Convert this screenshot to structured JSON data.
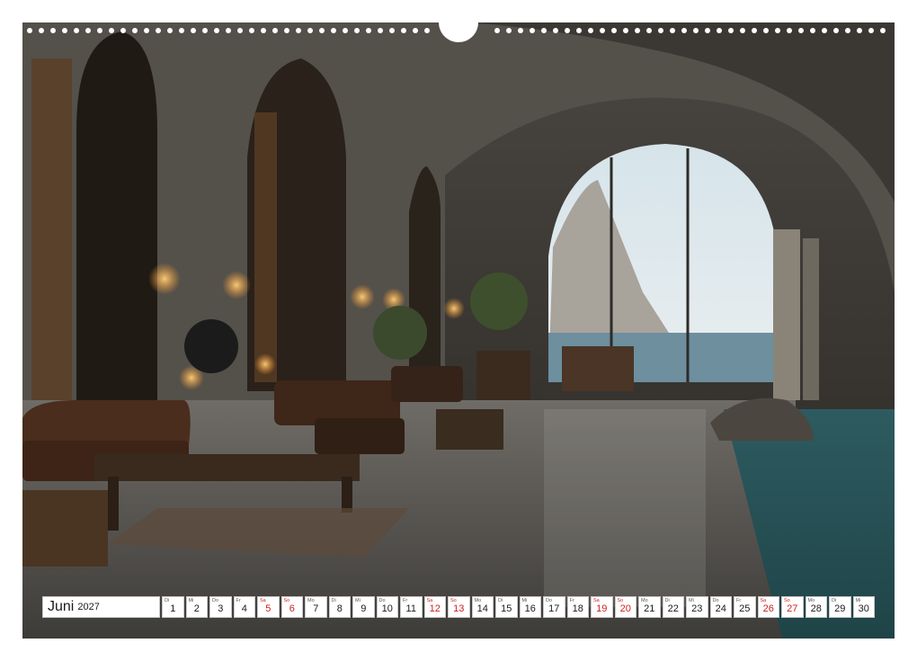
{
  "calendar": {
    "month": "Juni",
    "year": "2027",
    "days": [
      {
        "wd": "Di",
        "n": "1",
        "red": false
      },
      {
        "wd": "Mi",
        "n": "2",
        "red": false
      },
      {
        "wd": "Do",
        "n": "3",
        "red": false
      },
      {
        "wd": "Fr",
        "n": "4",
        "red": false
      },
      {
        "wd": "Sa",
        "n": "5",
        "red": true
      },
      {
        "wd": "So",
        "n": "6",
        "red": true
      },
      {
        "wd": "Mo",
        "n": "7",
        "red": false
      },
      {
        "wd": "Di",
        "n": "8",
        "red": false
      },
      {
        "wd": "Mi",
        "n": "9",
        "red": false
      },
      {
        "wd": "Do",
        "n": "10",
        "red": false
      },
      {
        "wd": "Fr",
        "n": "11",
        "red": false
      },
      {
        "wd": "Sa",
        "n": "12",
        "red": true
      },
      {
        "wd": "So",
        "n": "13",
        "red": true
      },
      {
        "wd": "Mo",
        "n": "14",
        "red": false
      },
      {
        "wd": "Di",
        "n": "15",
        "red": false
      },
      {
        "wd": "Mi",
        "n": "16",
        "red": false
      },
      {
        "wd": "Do",
        "n": "17",
        "red": false
      },
      {
        "wd": "Fr",
        "n": "18",
        "red": false
      },
      {
        "wd": "Sa",
        "n": "19",
        "red": true
      },
      {
        "wd": "So",
        "n": "20",
        "red": true
      },
      {
        "wd": "Mo",
        "n": "21",
        "red": false
      },
      {
        "wd": "Di",
        "n": "22",
        "red": false
      },
      {
        "wd": "Mi",
        "n": "23",
        "red": false
      },
      {
        "wd": "Do",
        "n": "24",
        "red": false
      },
      {
        "wd": "Fr",
        "n": "25",
        "red": false
      },
      {
        "wd": "Sa",
        "n": "26",
        "red": true
      },
      {
        "wd": "So",
        "n": "27",
        "red": true
      },
      {
        "wd": "Mo",
        "n": "28",
        "red": false
      },
      {
        "wd": "Di",
        "n": "29",
        "red": false
      },
      {
        "wd": "Mi",
        "n": "30",
        "red": false
      }
    ]
  },
  "colors": {
    "weekend": "#cc1f1f",
    "text": "#1a1a1a",
    "cell_background": "#ffffff"
  },
  "photo": {
    "subject": "cave-library-lounge-with-sea-view"
  }
}
